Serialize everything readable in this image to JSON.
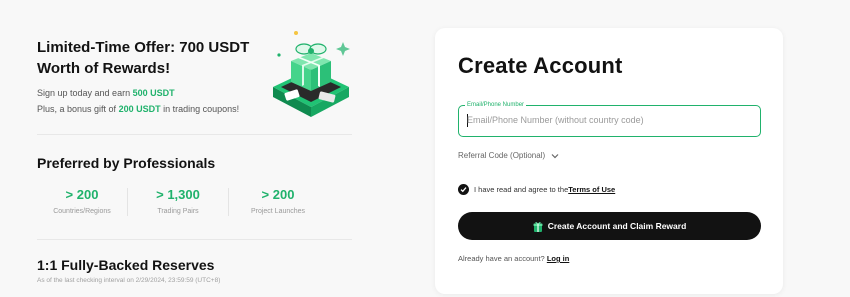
{
  "promo": {
    "offer_title": "Limited-Time Offer: 700 USDT Worth of Rewards!",
    "offer_line1_prefix": "Sign up today and earn ",
    "offer_line1_highlight": "500 USDT",
    "offer_line2_prefix": "Plus, a bonus gift of ",
    "offer_line2_highlight": "200 USDT",
    "offer_line2_suffix": " in trading coupons!",
    "gift_icon": "gift-box-illustration"
  },
  "professionals": {
    "title": "Preferred by Professionals",
    "stats": [
      {
        "value": "> 200",
        "label": "Countries/Regions"
      },
      {
        "value": "> 1,300",
        "label": "Trading Pairs"
      },
      {
        "value": "> 200",
        "label": "Project Launches"
      }
    ]
  },
  "reserves": {
    "title": "1:1 Fully-Backed Reserves",
    "subtitle": "As of the last checking interval on 2/29/2024, 23:59:59 (UTC+8)"
  },
  "signup": {
    "title": "Create Account",
    "field_label": "Email/Phone Number",
    "field_placeholder": "Email/Phone Number (without country code)",
    "field_value": "",
    "referral_label": "Referral Code (Optional)",
    "agree_prefix": "I have read and agree to the ",
    "terms_link": "Terms of Use",
    "cta_label": "Create Account and Claim Reward",
    "login_prefix": "Already have an account? ",
    "login_link": "Log in"
  },
  "colors": {
    "accent": "#20b26c",
    "button_bg": "#121212",
    "page_bg": "#f8f8f8",
    "card_bg": "#ffffff"
  }
}
